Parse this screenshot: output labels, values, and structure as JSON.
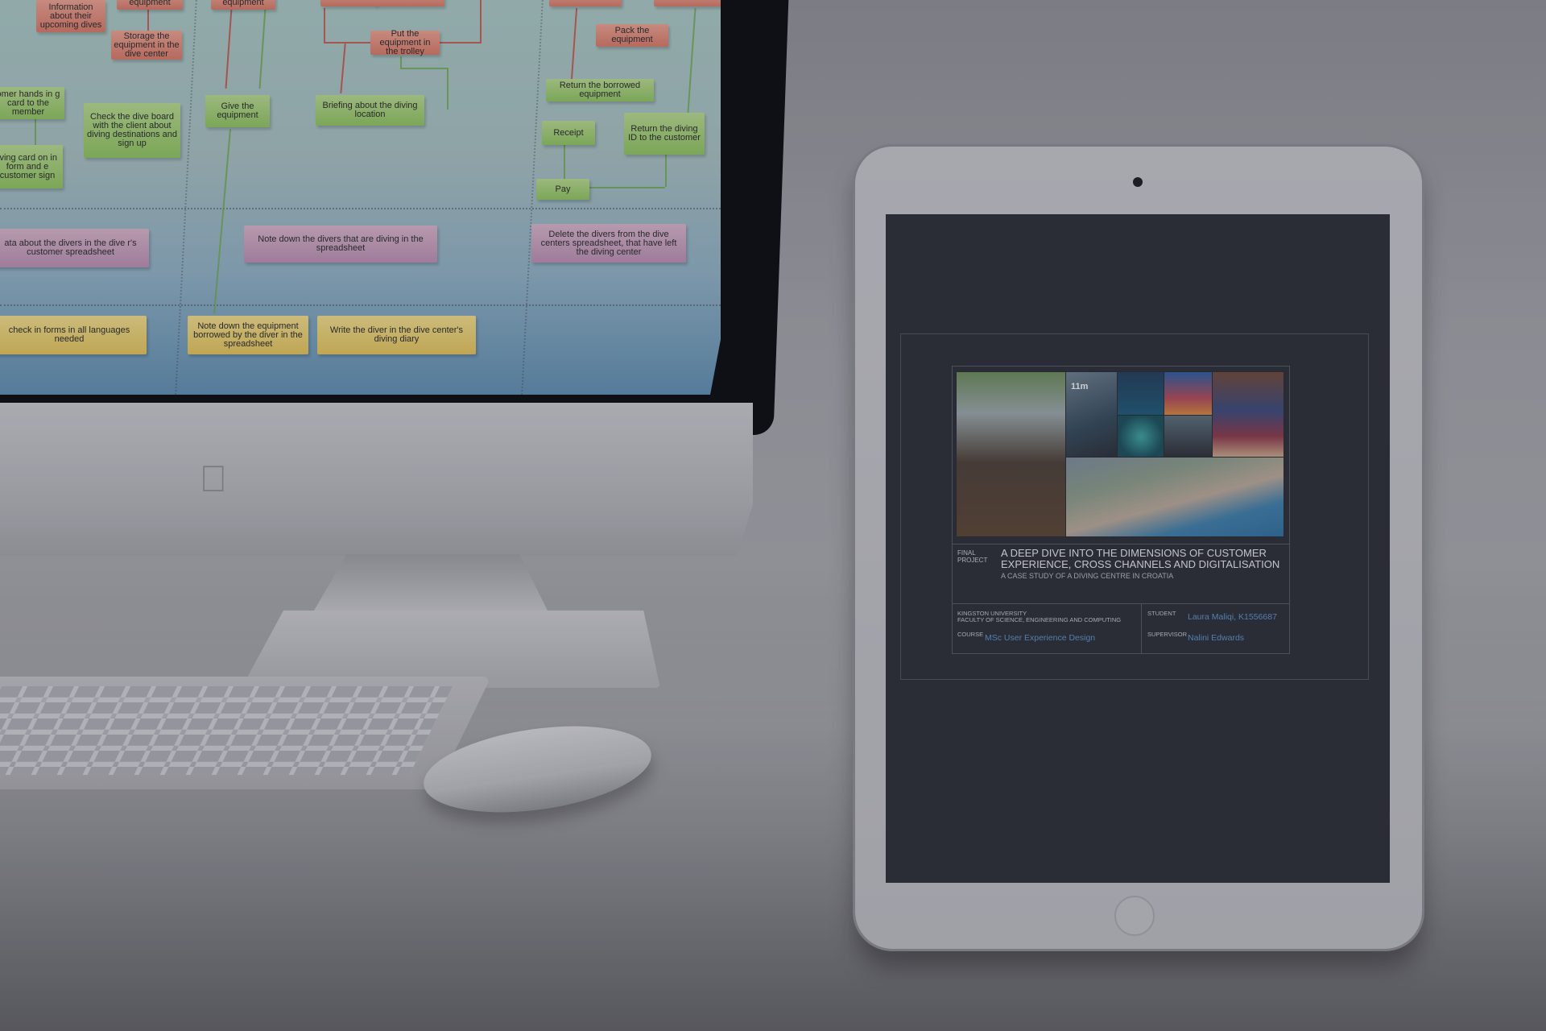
{
  "flowchart": {
    "boxes": [
      {
        "id": "b1",
        "text": "Information about their upcoming dives"
      },
      {
        "id": "b2",
        "text": "equipment"
      },
      {
        "id": "b3",
        "text": "Storage the equipment in the dive center"
      },
      {
        "id": "b4",
        "text": "equipment"
      },
      {
        "id": "b5",
        "text": "Put the equipment in the trolley"
      },
      {
        "id": "b6",
        "text": "Pack the equipment"
      },
      {
        "id": "b7",
        "text": "omer hands in g card to the member"
      },
      {
        "id": "b8",
        "text": "Give the equipment"
      },
      {
        "id": "b9",
        "text": "Briefing about the diving location"
      },
      {
        "id": "b10",
        "text": "Return the borrowed equipment"
      },
      {
        "id": "b11",
        "text": "Check the dive board with the client about diving destinations and sign up"
      },
      {
        "id": "b12",
        "text": "Receipt"
      },
      {
        "id": "b13",
        "text": "Return the diving ID to the customer"
      },
      {
        "id": "b14",
        "text": "iving card on in form and e customer sign"
      },
      {
        "id": "b15",
        "text": "Pay"
      },
      {
        "id": "b16",
        "text": "ata about the divers in the dive r's customer spreadsheet"
      },
      {
        "id": "b17",
        "text": "Note down the divers that are diving in the spreadsheet"
      },
      {
        "id": "b18",
        "text": "Delete the divers from the dive centers spreadsheet, that have left the diving center"
      },
      {
        "id": "b19",
        "text": "check in forms in all languages needed"
      },
      {
        "id": "b20",
        "text": "Note down the equipment borrowed by the diver in the spreadsheet"
      },
      {
        "id": "b21",
        "text": "Write the diver in the dive center's diving diary"
      }
    ]
  },
  "document": {
    "label": "FINAL PROJECT",
    "title": "A DEEP DIVE INTO THE DIMENSIONS OF CUSTOMER EXPERIENCE, CROSS CHANNELS AND DIGITALISATION",
    "subtitle": "A CASE STUDY OF A DIVING CENTRE IN CROATIA",
    "university": "KINGSTON UNIVERSITY",
    "faculty": "FACULTY OF SCIENCE, ENGINEERING AND COMPUTING",
    "course_label": "COURSE",
    "course": "MSc User Experience Design",
    "student_label": "STUDENT",
    "student": "Laura Maliqi, K1556687",
    "supervisor_label": "SUPERVISOR",
    "supervisor": "Nalini Edwards",
    "photo_sign": "11m"
  },
  "colors": {
    "flow_red": "#d77967",
    "flow_green": "#8fc35f",
    "flow_purple": "#b98fb1",
    "flow_yellow": "#e2c35b",
    "doc_background": "#2d2f36",
    "link_blue": "#5b93c9"
  },
  "icons": [
    "apple-logo-icon",
    "ipad-camera-icon",
    "home-button-icon"
  ]
}
